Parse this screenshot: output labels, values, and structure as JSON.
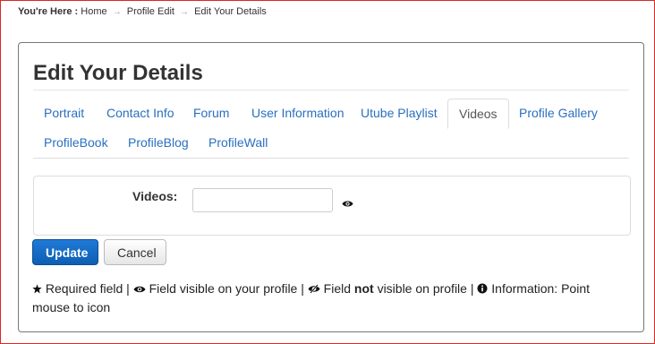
{
  "breadcrumb": {
    "title": "You're Here :",
    "items": [
      "Home",
      "Profile Edit",
      "Edit Your Details"
    ],
    "separator": "→"
  },
  "page": {
    "title": "Edit Your Details"
  },
  "tabs": [
    {
      "label": "Portrait"
    },
    {
      "label": "Contact Info"
    },
    {
      "label": "Forum"
    },
    {
      "label": "User Information"
    },
    {
      "label": "Utube Playlist"
    },
    {
      "label": "Videos",
      "active": true
    },
    {
      "label": "Profile Gallery"
    },
    {
      "label": "ProfileBook"
    },
    {
      "label": "ProfileBlog"
    },
    {
      "label": "ProfileWall"
    }
  ],
  "form": {
    "videos_label": "Videos:",
    "videos_value": "",
    "visibility_icon": "eye-icon"
  },
  "buttons": {
    "update": "Update",
    "cancel": "Cancel"
  },
  "legend": {
    "required": "Required field |",
    "visible": "Field visible on your profile |",
    "not_visible_pre": "Field",
    "not_visible_bold": "not",
    "not_visible_post": "visible on profile |",
    "info": "Information: Point mouse to icon"
  },
  "colors": {
    "link": "#2a6fc1",
    "primary_button": "#0d5fb3",
    "frame_border": "#d72a2a"
  }
}
